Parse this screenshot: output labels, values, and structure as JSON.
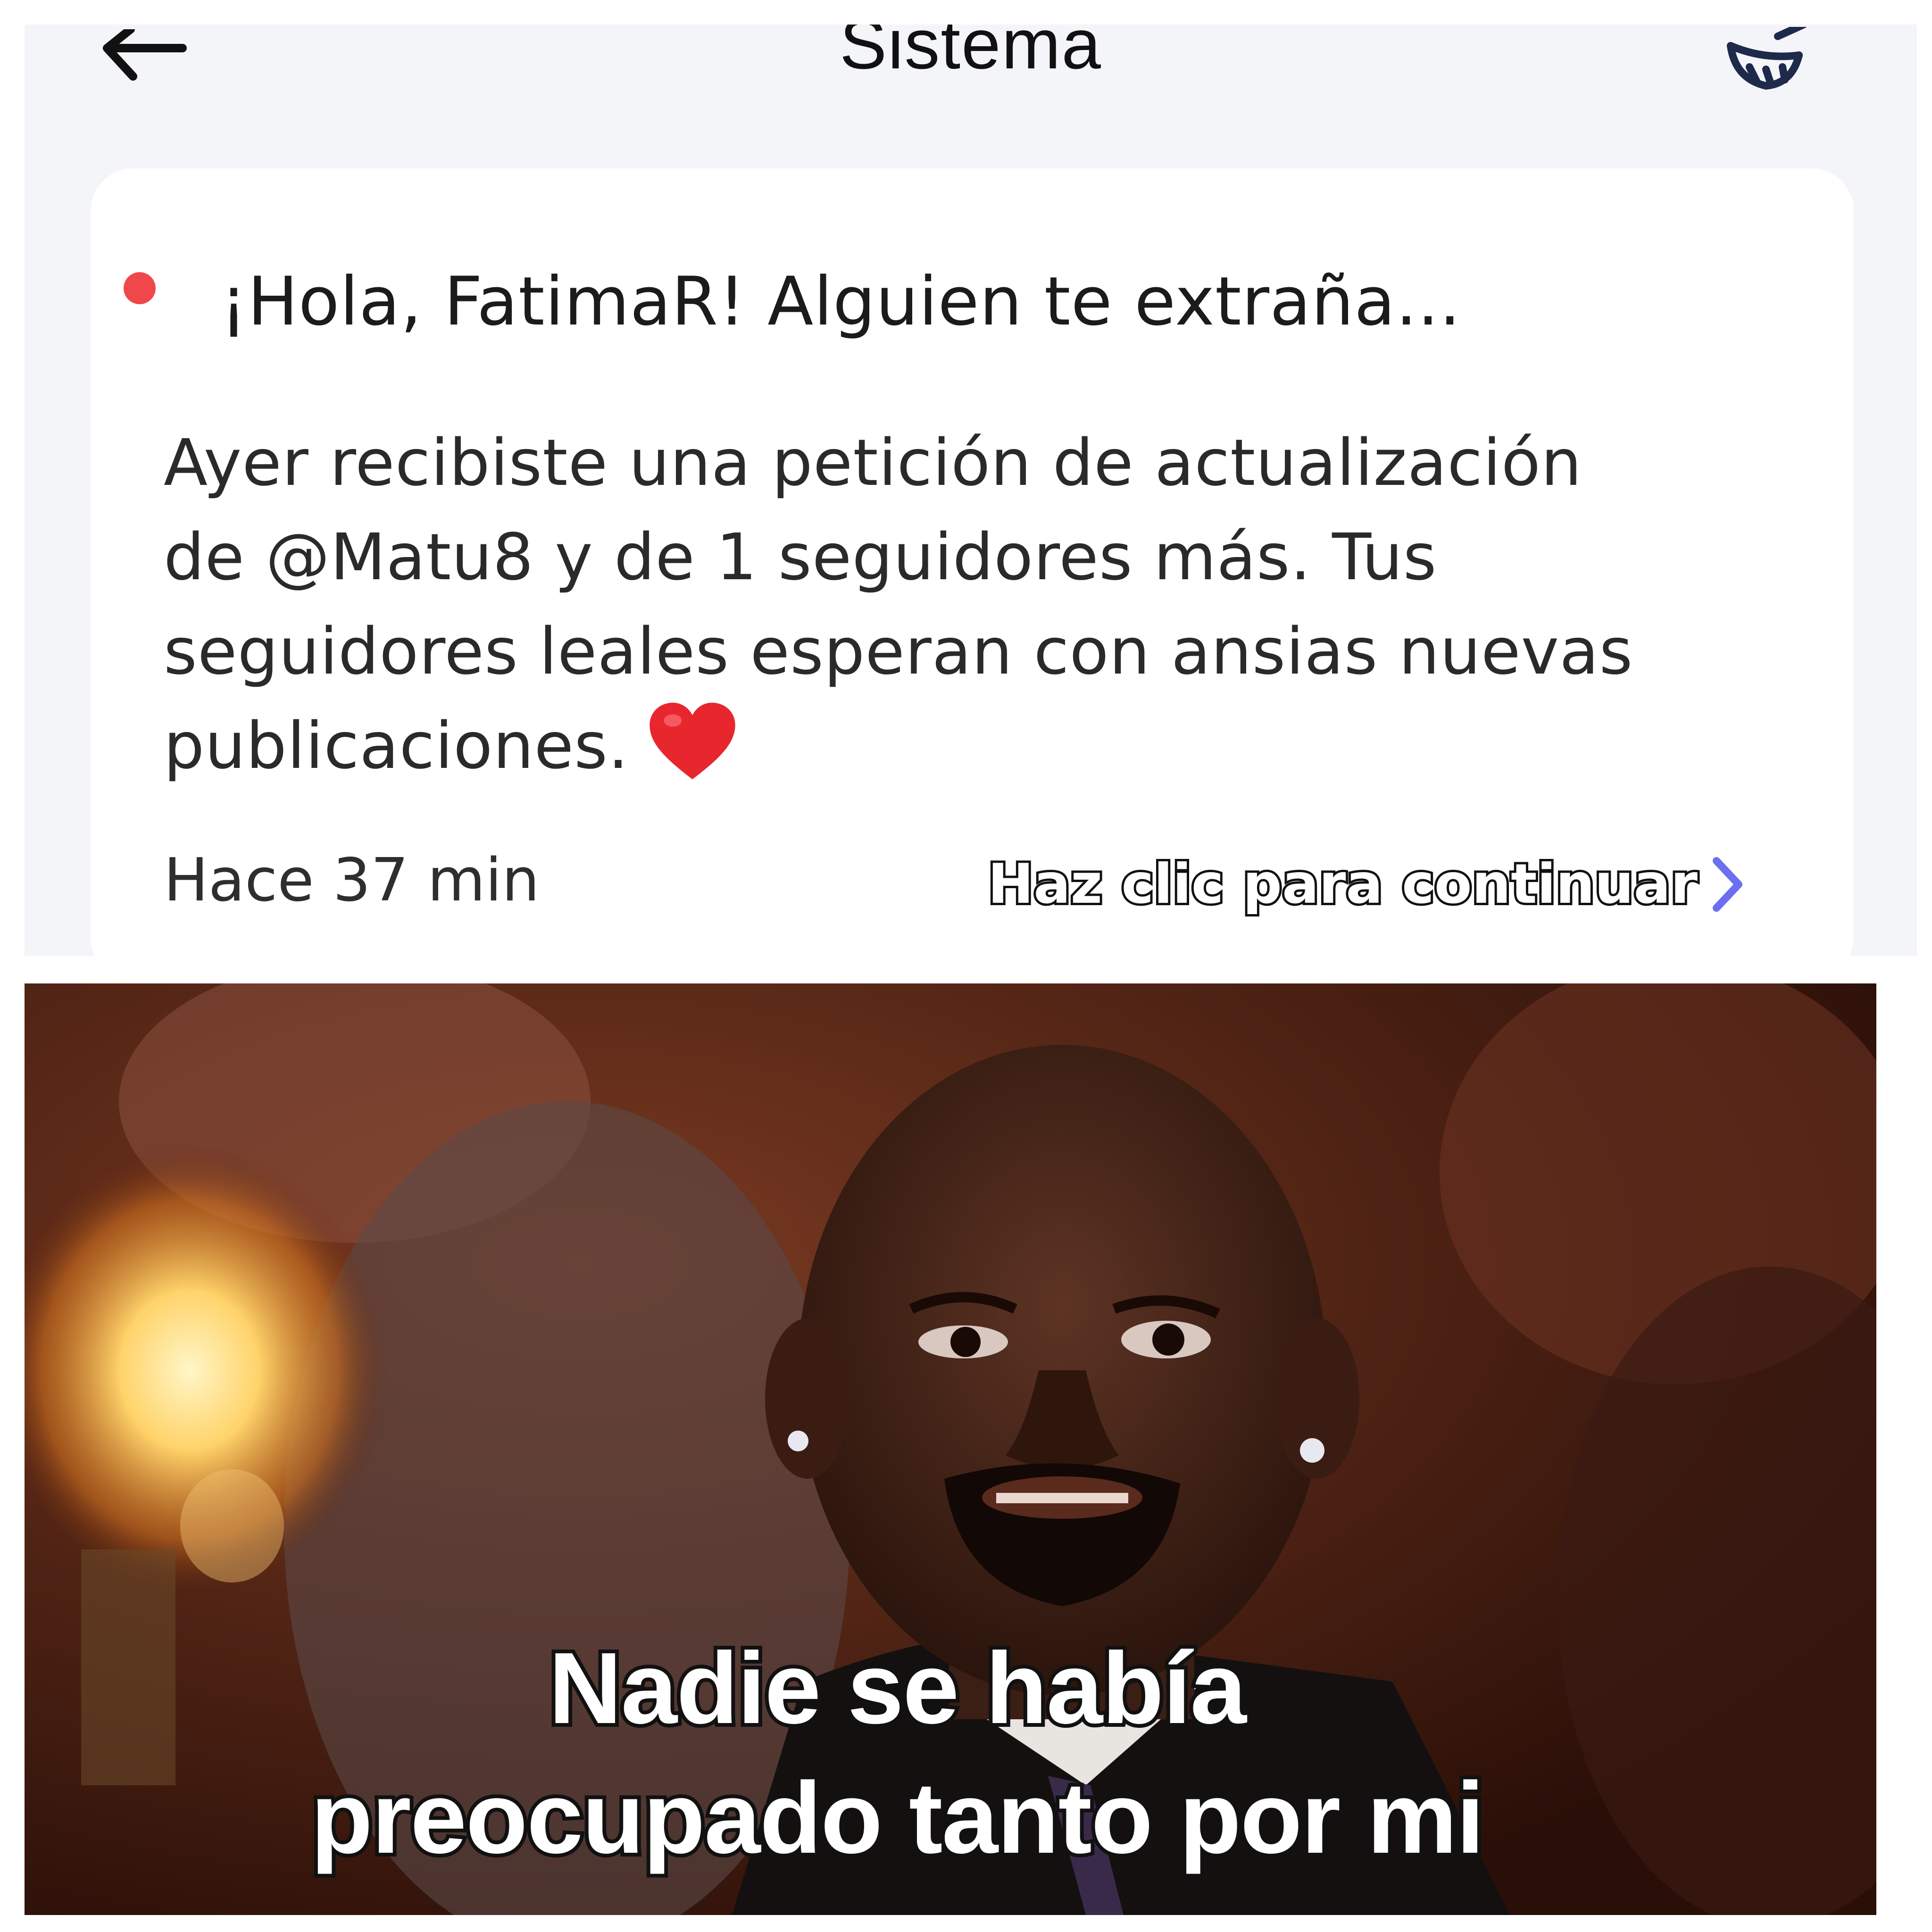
{
  "header": {
    "title": "Sistema",
    "back_icon": "back-arrow-icon",
    "clean_icon": "broom-icon"
  },
  "notification": {
    "unread_color": "#f0474b",
    "title": "¡Hola, FatimaR! Alguien te extraña...",
    "body_lines": [
      "Ayer recibiste una petición de actualización",
      "de @Matu8 y de 1 seguidores más. Tus",
      "seguidores leales esperan con ansias nuevas",
      "publicaciones."
    ],
    "body_emoji_icon": "red-heart-icon",
    "timestamp": "Hace 37 min",
    "continue_label": "Haz clic para continuar",
    "continue_icon": "chevron-right-icon",
    "accent_color": "#6b6ff0"
  },
  "meme": {
    "caption_lines": [
      "Nadie se había",
      "preocupado tanto por mi"
    ]
  }
}
